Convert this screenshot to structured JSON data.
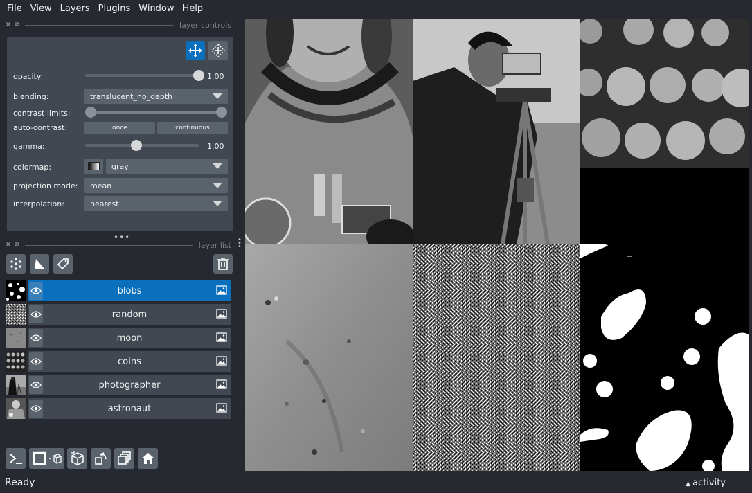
{
  "menu": [
    {
      "label": "File",
      "mnemonic": "F",
      "rest": "ile"
    },
    {
      "label": "View",
      "mnemonic": "V",
      "rest": "iew"
    },
    {
      "label": "Layers",
      "mnemonic": "L",
      "rest": "ayers"
    },
    {
      "label": "Plugins",
      "mnemonic": "P",
      "rest": "lugins"
    },
    {
      "label": "Window",
      "mnemonic": "W",
      "rest": "indow"
    },
    {
      "label": "Help",
      "mnemonic": "H",
      "rest": "elp"
    }
  ],
  "layer_controls": {
    "title": "layer controls",
    "opacity_label": "opacity:",
    "opacity_value": "1.00",
    "opacity_fraction": 1.0,
    "blending_label": "blending:",
    "blending_value": "translucent_no_depth",
    "contrast_label": "contrast limits:",
    "auto_contrast_label": "auto-contrast:",
    "once_label": "once",
    "continuous_label": "continuous",
    "gamma_label": "gamma:",
    "gamma_value": "1.00",
    "gamma_fraction": 0.45,
    "colormap_label": "colormap:",
    "colormap_value": "gray",
    "projection_label": "projection mode:",
    "projection_value": "mean",
    "interpolation_label": "interpolation:",
    "interpolation_value": "nearest"
  },
  "layer_list": {
    "title": "layer list",
    "layers": [
      {
        "name": "blobs",
        "selected": true
      },
      {
        "name": "random",
        "selected": false
      },
      {
        "name": "moon",
        "selected": false
      },
      {
        "name": "coins",
        "selected": false
      },
      {
        "name": "photographer",
        "selected": false
      },
      {
        "name": "astronaut",
        "selected": false
      }
    ]
  },
  "status": {
    "text": "Ready",
    "activity": "activity"
  },
  "colors": {
    "background": "#262930",
    "panel": "#414851",
    "accent": "#0a6fbd",
    "button": "#5a626c"
  }
}
